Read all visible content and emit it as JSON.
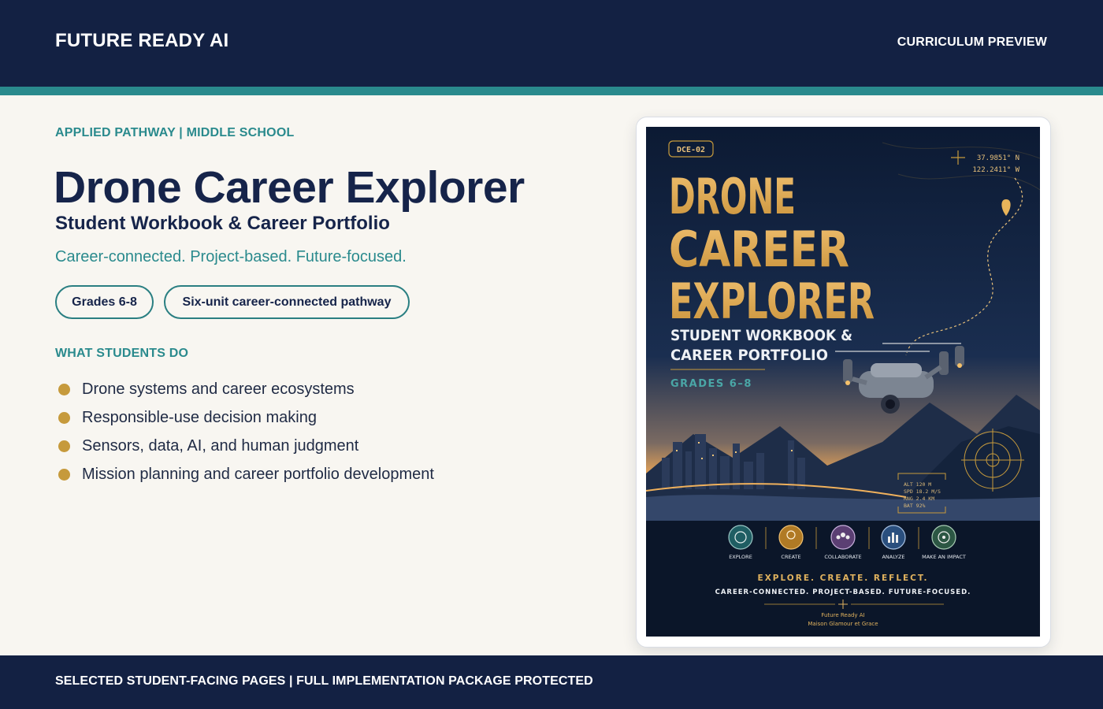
{
  "header": {
    "brand": "FUTURE READY AI",
    "link_label": "CURRICULUM PREVIEW"
  },
  "hero": {
    "eyebrow": "APPLIED PATHWAY | MIDDLE SCHOOL",
    "title": "Drone Career Explorer",
    "subtitle": "Student Workbook & Career Portfolio",
    "tagline": "Career-connected. Project-based. Future-focused.",
    "pills": [
      "Grades 6-8",
      "Six-unit career-connected pathway"
    ]
  },
  "activities": {
    "label": "WHAT STUDENTS DO",
    "items": [
      "Drone systems and career ecosystems",
      "Responsible-use decision making",
      "Sensors, data, AI, and human judgment",
      "Mission planning and career portfolio development"
    ]
  },
  "cover": {
    "code": "DCE-02",
    "title_lines": [
      "DRONE",
      "CAREER",
      "EXPLORER"
    ],
    "subtitle_lines": [
      "STUDENT WORKBOOK &",
      "CAREER PORTFOLIO"
    ],
    "grades": "GRADES 6–8",
    "coords": [
      "37.9851° N",
      "122.2411° W"
    ],
    "hud": [
      "ALT   120 M",
      "SPD  18.2 M/S",
      "RNG   2.4 KM",
      "BAT   92%"
    ],
    "icon_labels": [
      "EXPLORE",
      "CREATE",
      "COLLABORATE",
      "ANALYZE",
      "MAKE AN IMPACT"
    ],
    "motto": "EXPLORE. CREATE. REFLECT.",
    "tagline": "CAREER-CONNECTED. PROJECT-BASED. FUTURE-FOCUSED.",
    "publisher": "Future Ready AI",
    "imprint": "Maison Glamour et Grace"
  },
  "footer": {
    "text": "SELECTED STUDENT-FACING PAGES | FULL IMPLEMENTATION PACKAGE PROTECTED"
  },
  "colors": {
    "navy": "#132143",
    "teal": "#2a8a8d",
    "gold": "#c69a3c",
    "background": "#f8f6f1"
  }
}
